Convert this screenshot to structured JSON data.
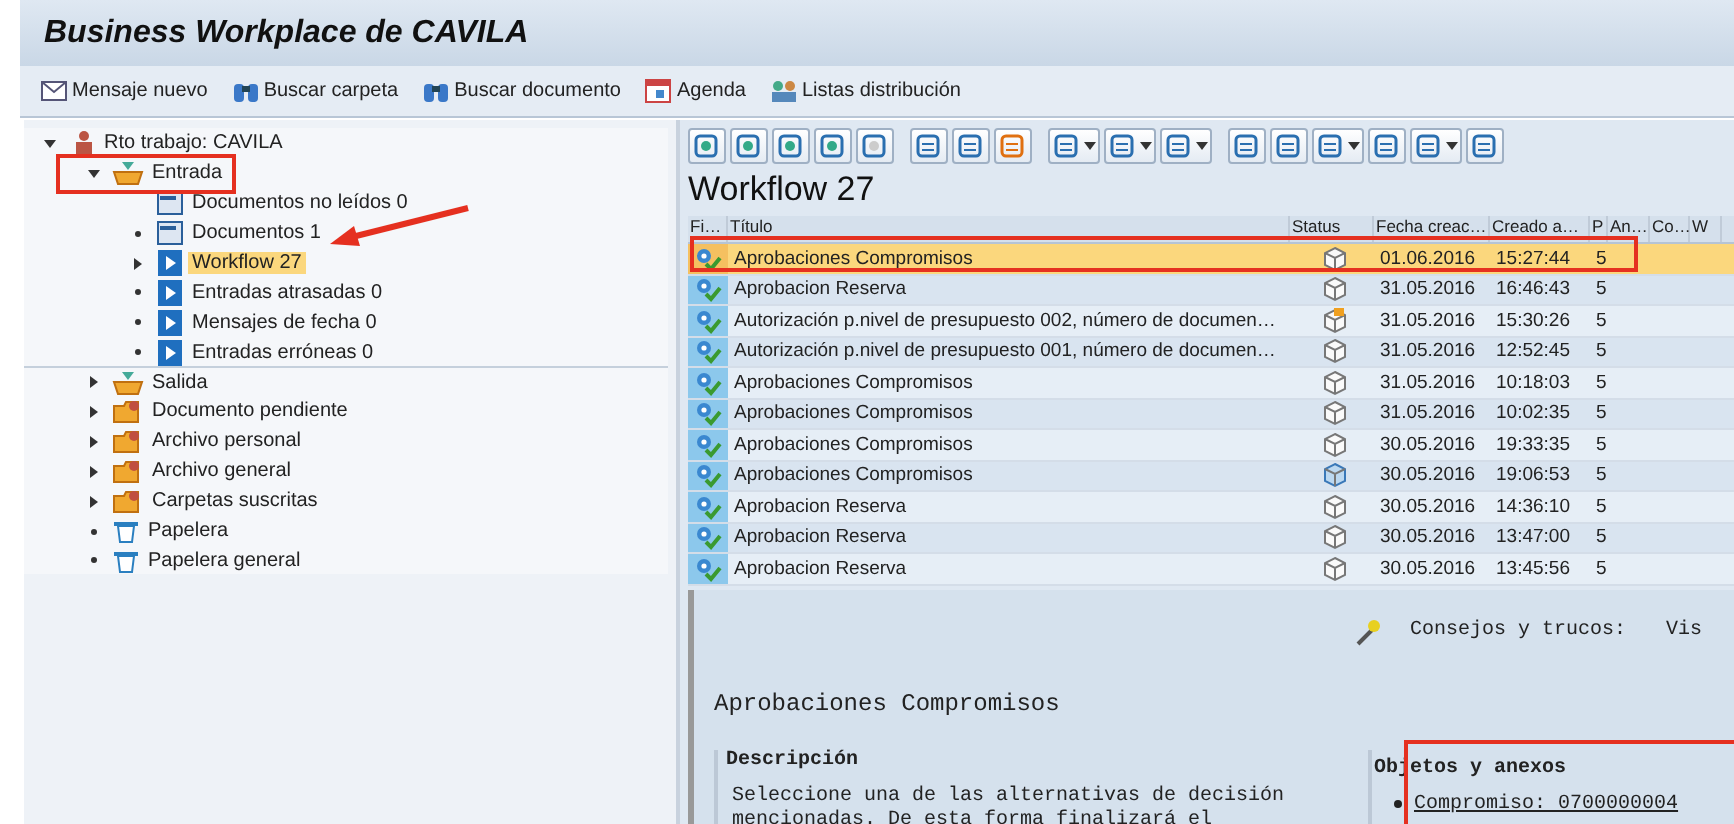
{
  "window": {
    "title": "Business Workplace de CAVILA"
  },
  "toolbar": [
    {
      "label": "Mensaje nuevo",
      "kind": "new"
    },
    {
      "label": "Buscar carpeta",
      "kind": "find"
    },
    {
      "label": "Buscar documento",
      "kind": "find"
    },
    {
      "label": "Agenda",
      "kind": "calendar"
    },
    {
      "label": "Listas distribución",
      "kind": "people"
    }
  ],
  "tree": {
    "label": "Rto trabajo: CAVILA",
    "kind": "workplace",
    "expanded": true,
    "selected": false,
    "children": [
      {
        "label": "Entrada",
        "kind": "inbox",
        "expanded": true,
        "selected": false,
        "children": [
          {
            "label": "Documentos no leídos 0",
            "kind": "doc",
            "selected": false
          },
          {
            "label": "Documentos 1",
            "kind": "doc",
            "bullet": true,
            "selected": false
          },
          {
            "label": "Workflow 27",
            "kind": "workflow",
            "expanded": false,
            "selected": true
          },
          {
            "label": "Entradas atrasadas 0",
            "kind": "workflow",
            "bullet": true,
            "selected": false
          },
          {
            "label": "Mensajes de fecha 0",
            "kind": "workflow",
            "bullet": true,
            "selected": false
          },
          {
            "label": "Entradas erróneas 0",
            "kind": "workflow",
            "bullet": true,
            "selected": false
          }
        ]
      },
      {
        "label": "Salida",
        "kind": "inbox",
        "expanded": false,
        "selected": false
      },
      {
        "label": "Documento pendiente",
        "kind": "folder",
        "expanded": false,
        "selected": false
      },
      {
        "label": "Archivo personal",
        "kind": "folder",
        "expanded": false,
        "selected": false
      },
      {
        "label": "Archivo general",
        "kind": "folder",
        "expanded": false,
        "selected": false
      },
      {
        "label": "Carpetas suscritas",
        "kind": "folder",
        "expanded": false,
        "selected": false
      },
      {
        "label": "Papelera",
        "kind": "trash",
        "bullet": true,
        "selected": false
      },
      {
        "label": "Papelera general",
        "kind": "trash",
        "bullet": true,
        "selected": false
      }
    ]
  },
  "list": {
    "title": "Workflow 27",
    "columns": [
      "Fi…",
      "Título",
      "Status",
      "Fecha creac…",
      "Creado a…",
      "P",
      "An…",
      "Co…",
      "W"
    ],
    "rows": [
      {
        "title": "Aprobaciones Compromisos",
        "kind": "plain",
        "date": "01.06.2016",
        "time": "15:27:44",
        "priority": "5",
        "selected": true
      },
      {
        "title": "Aprobacion Reserva",
        "kind": "plain",
        "date": "31.05.2016",
        "time": "16:46:43",
        "priority": "5",
        "selected": false
      },
      {
        "title": "Autorización p.nivel de presupuesto 002, número de documen…",
        "kind": "flagged",
        "date": "31.05.2016",
        "time": "15:30:26",
        "priority": "5",
        "selected": false
      },
      {
        "title": "Autorización p.nivel de presupuesto 001, número de documen…",
        "kind": "plain",
        "date": "31.05.2016",
        "time": "12:52:45",
        "priority": "5",
        "selected": false
      },
      {
        "title": "Aprobaciones Compromisos",
        "kind": "plain",
        "date": "31.05.2016",
        "time": "10:18:03",
        "priority": "5",
        "selected": false
      },
      {
        "title": "Aprobaciones Compromisos",
        "kind": "plain",
        "date": "31.05.2016",
        "time": "10:02:35",
        "priority": "5",
        "selected": false
      },
      {
        "title": "Aprobaciones Compromisos",
        "kind": "plain",
        "date": "30.05.2016",
        "time": "19:33:35",
        "priority": "5",
        "selected": false
      },
      {
        "title": "Aprobaciones Compromisos",
        "kind": "started",
        "date": "30.05.2016",
        "time": "19:06:53",
        "priority": "5",
        "selected": false
      },
      {
        "title": "Aprobacion Reserva",
        "kind": "plain",
        "date": "30.05.2016",
        "time": "14:36:10",
        "priority": "5",
        "selected": false
      },
      {
        "title": "Aprobacion Reserva",
        "kind": "plain",
        "date": "30.05.2016",
        "time": "13:47:00",
        "priority": "5",
        "selected": false
      },
      {
        "title": "Aprobacion Reserva",
        "kind": "plain",
        "date": "30.05.2016",
        "time": "13:45:56",
        "priority": "5",
        "selected": false
      }
    ]
  },
  "preview": {
    "tips_label": "Consejos y trucos:",
    "tips_text": "Vis",
    "heading": "Aprobaciones Compromisos",
    "description_title": "Descripción",
    "description": "Seleccione una de las alternativas de decisión mencionadas. De esta forma finalizará el",
    "objects_title": "Objetos y anexos",
    "objects": [
      "Compromiso: 0700000004"
    ]
  }
}
